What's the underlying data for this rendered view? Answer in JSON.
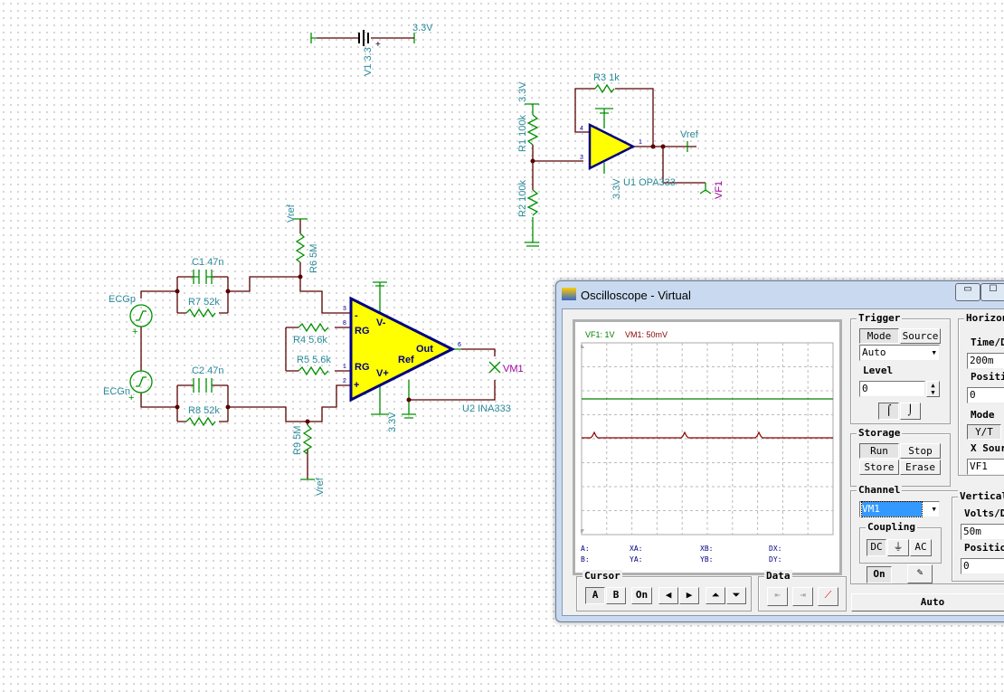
{
  "schematic": {
    "v1": {
      "name": "V1 3.3",
      "net": "3.3V"
    },
    "r1": "R1 100k",
    "r1_net": "3.3V",
    "r2": "R2 100k",
    "r3": "R3 1k",
    "u1": "U1 OPA333",
    "u1_supply": "3.3V",
    "vref_out": "Vref",
    "vf1": "VF1",
    "pins_u1": [
      "4",
      "3",
      "1",
      "2",
      "5"
    ],
    "ecgp": "ECGp",
    "ecgn": "ECGn",
    "c1": "C1 47n",
    "c2": "C2 47n",
    "r7": "R7 52k",
    "r8": "R8 52k",
    "r6": "R6 5M",
    "r9": "R9 5M",
    "r6_net": "Vref",
    "r9_net": "Vref",
    "r4": "R4 5.6k",
    "r5": "R5 5.6k",
    "u2": "U2 INA333",
    "u2_supply": "3.3V",
    "vm1": "VM1",
    "u2_pins": {
      "rg": "RG",
      "vminus": "V-",
      "vplus": "V+",
      "out": "Out",
      "ref": "Ref",
      "minus": "-",
      "plus": "+"
    },
    "pins_u2": [
      "3",
      "8",
      "1",
      "2",
      "4",
      "7",
      "6",
      "5"
    ]
  },
  "scope": {
    "title": "Oscilloscope - Virtual",
    "legend": {
      "vf1": "VF1: 1V",
      "vm1": "VM1: 50mV"
    },
    "colors": {
      "vf1": "#008000",
      "vm1": "#8b0000"
    },
    "readouts": {
      "a": "A:",
      "b": "B:",
      "xa": "XA:",
      "ya": "YA:",
      "xb": "XB:",
      "yb": "YB:",
      "dx": "DX:",
      "dy": "DY:"
    },
    "trigger": {
      "title": "Trigger",
      "mode": "Mode",
      "source": "Source",
      "mode_value": "Auto",
      "level_label": "Level",
      "level": "0"
    },
    "horizontal": {
      "title": "Horizontal",
      "time_label": "Time/Div",
      "time": "200m",
      "pos_label": "Position",
      "pos": "0",
      "mode_label": "Mode",
      "mode": "Y/T",
      "xsrc_label": "X Source",
      "xsrc": "VF1"
    },
    "storage": {
      "title": "Storage",
      "run": "Run",
      "stop": "Stop",
      "store": "Store",
      "erase": "Erase"
    },
    "channel": {
      "title": "Channel",
      "value": "VM1",
      "coupling": "Coupling",
      "dc": "DC",
      "ac": "AC",
      "on": "On"
    },
    "vertical": {
      "title": "Vertical",
      "volts_label": "Volts/Div",
      "volts": "50m",
      "pos_label": "Position",
      "pos": "0"
    },
    "cursor": {
      "title": "Cursor",
      "a": "A",
      "b": "B",
      "on": "On"
    },
    "data": {
      "title": "Data"
    },
    "auto": "Auto"
  }
}
